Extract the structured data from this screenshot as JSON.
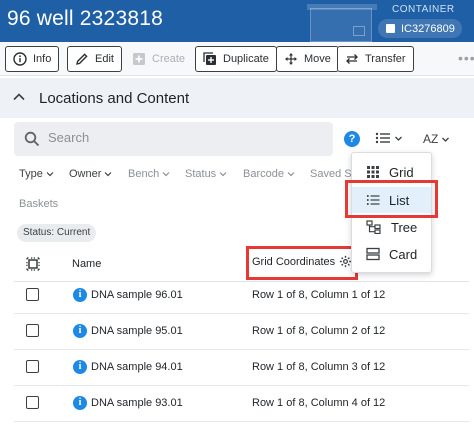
{
  "header": {
    "title": "96 well 2323818",
    "container_type": "CONTAINER",
    "container_id": "IC3276809"
  },
  "toolbar": {
    "info": "Info",
    "edit": "Edit",
    "create": "Create",
    "duplicate": "Duplicate",
    "move": "Move",
    "transfer": "Transfer",
    "more": "•••"
  },
  "section": {
    "title": "Locations and Content"
  },
  "search": {
    "placeholder": "Search",
    "help": "?"
  },
  "sort": {
    "label": "AZ"
  },
  "filters": {
    "type": "Type",
    "owner": "Owner",
    "bench": "Bench",
    "status": "Status",
    "barcode": "Barcode",
    "saved": "Saved S",
    "baskets": "Baskets"
  },
  "status_chip": "Status: Current",
  "table": {
    "columns": {
      "name": "Name",
      "grid": "Grid Coordinates"
    },
    "rows": [
      {
        "name": "DNA sample 96.01",
        "coord": "Row 1 of 8, Column 1 of 12"
      },
      {
        "name": "DNA sample 95.01",
        "coord": "Row 1 of 8, Column 2 of 12"
      },
      {
        "name": "DNA sample 94.01",
        "coord": "Row 1 of 8, Column 3 of 12"
      },
      {
        "name": "DNA sample 93.01",
        "coord": "Row 1 of 8, Column 4 of 12"
      }
    ]
  },
  "view_menu": {
    "items": [
      {
        "label": "Grid",
        "icon": "grid-icon"
      },
      {
        "label": "List",
        "icon": "list-icon",
        "active": true
      },
      {
        "label": "Tree",
        "icon": "tree-icon"
      },
      {
        "label": "Card",
        "icon": "card-icon"
      }
    ]
  },
  "colors": {
    "header": "#1f5fa6",
    "accent": "#1e88e5",
    "highlight": "#e53935",
    "active_item": "#e3f0fb"
  }
}
